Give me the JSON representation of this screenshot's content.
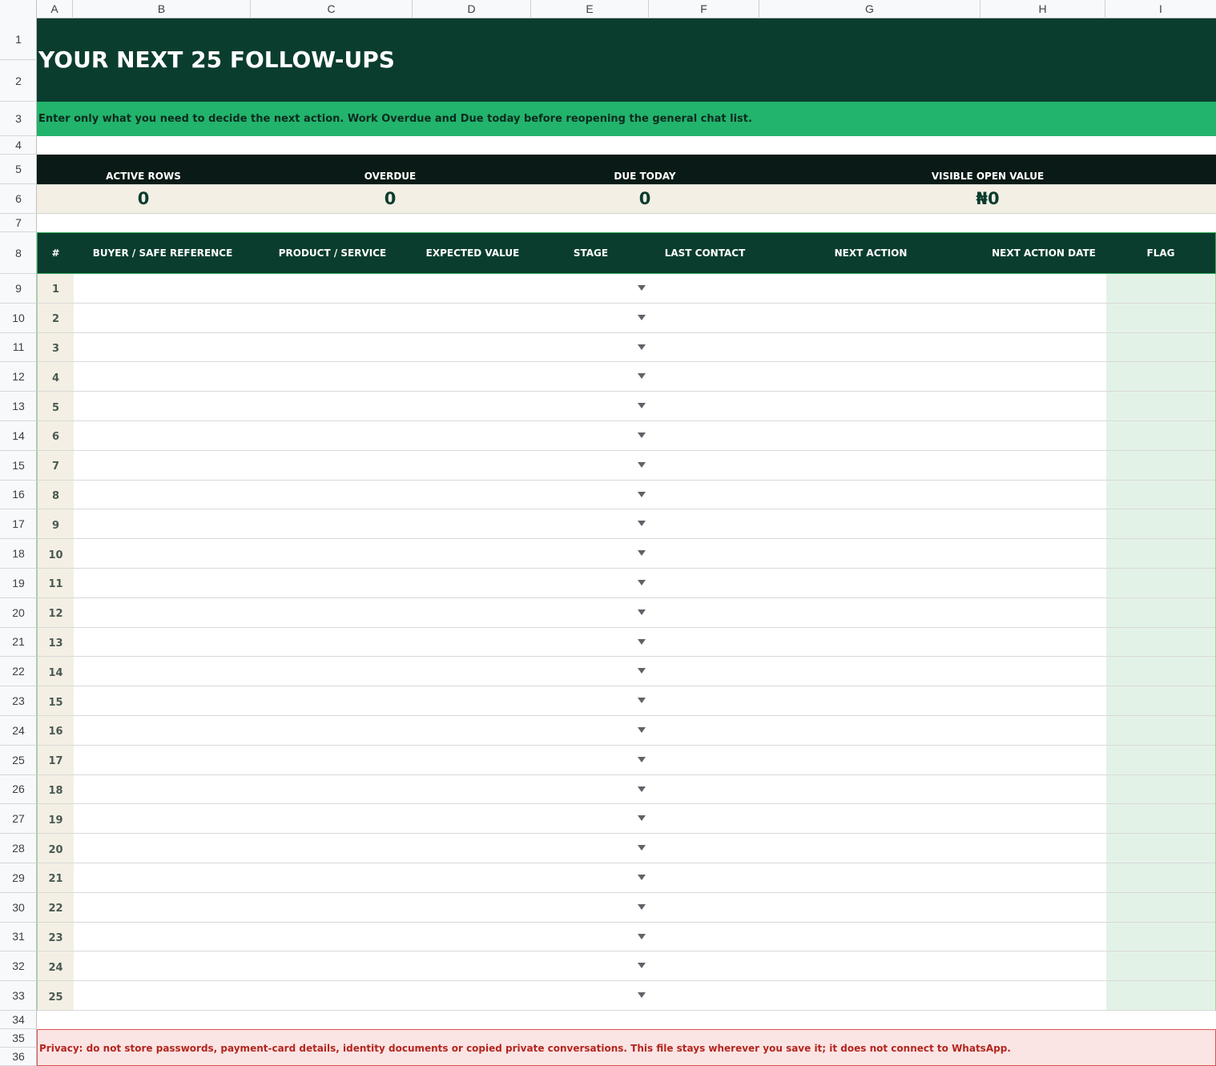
{
  "columns": [
    "A",
    "B",
    "C",
    "D",
    "E",
    "F",
    "G",
    "H",
    "I"
  ],
  "row_numbers": [
    "1",
    "2",
    "3",
    "4",
    "5",
    "6",
    "7",
    "8",
    "9",
    "10",
    "11",
    "12",
    "13",
    "14",
    "15",
    "16",
    "17",
    "18",
    "19",
    "20",
    "21",
    "22",
    "23",
    "24",
    "25",
    "26",
    "27",
    "28",
    "29",
    "30",
    "31",
    "32",
    "33",
    "34",
    "35",
    "36"
  ],
  "title": "YOUR NEXT 25 FOLLOW-UPS",
  "subtitle": "Enter only what you need to decide the next action. Work Overdue and Due today before reopening the general chat list.",
  "kpis": [
    {
      "label": "ACTIVE ROWS",
      "value": "0"
    },
    {
      "label": "OVERDUE",
      "value": "0"
    },
    {
      "label": "DUE TODAY",
      "value": "0"
    },
    {
      "label": "VISIBLE OPEN VALUE",
      "value": "₦0"
    }
  ],
  "table": {
    "headers": [
      "#",
      "BUYER / SAFE REFERENCE",
      "PRODUCT / SERVICE",
      "EXPECTED VALUE",
      "STAGE",
      "LAST CONTACT",
      "NEXT ACTION",
      "NEXT ACTION DATE",
      "FLAG"
    ],
    "row_ids": [
      "1",
      "2",
      "3",
      "4",
      "5",
      "6",
      "7",
      "8",
      "9",
      "10",
      "11",
      "12",
      "13",
      "14",
      "15",
      "16",
      "17",
      "18",
      "19",
      "20",
      "21",
      "22",
      "23",
      "24",
      "25"
    ]
  },
  "privacy_note": "Privacy: do not store passwords, payment-card details, identity documents or copied private conversations. This file stays wherever you save it; it does not connect to WhatsApp.",
  "colors": {
    "title_band": "#0b3d2e",
    "subtitle_band": "#22b46c",
    "kpi_header_band": "#0a1a16",
    "kpi_value_band": "#f3efe4",
    "flag_column": "#e3f2e7",
    "privacy_band": "#fbe4e4",
    "privacy_text": "#b3261e"
  },
  "icons": {
    "stage_dropdown": "dropdown-arrow-icon"
  }
}
